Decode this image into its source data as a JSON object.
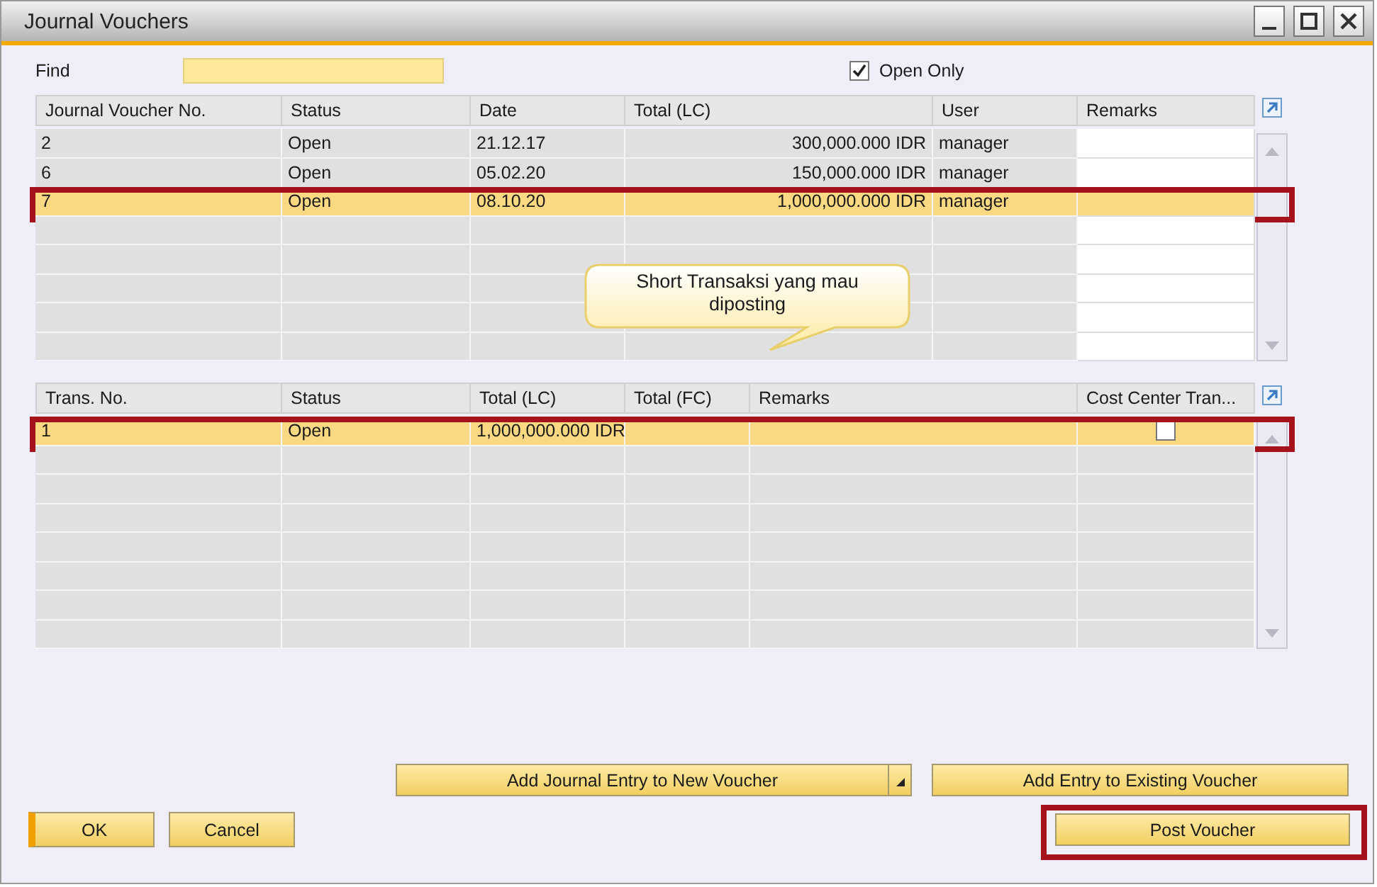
{
  "window": {
    "title": "Journal Vouchers"
  },
  "find": {
    "label": "Find"
  },
  "open_only": {
    "label": "Open Only",
    "checked": true
  },
  "vouchers": {
    "columns": [
      {
        "label": "Journal Voucher No.",
        "kind": "text"
      },
      {
        "label": "Status",
        "kind": "text"
      },
      {
        "label": "Date",
        "kind": "text"
      },
      {
        "label": "Total (LC)",
        "kind": "amount"
      },
      {
        "label": "User",
        "kind": "text"
      },
      {
        "label": "Remarks",
        "kind": "editable"
      }
    ],
    "rows": [
      {
        "cells": [
          "2",
          "Open",
          "21.12.17",
          "300,000.000 IDR",
          "manager"
        ],
        "selected": false,
        "highlighted": false
      },
      {
        "cells": [
          "6",
          "Open",
          "05.02.20",
          "150,000.000 IDR",
          "manager"
        ],
        "selected": false,
        "highlighted": false
      },
      {
        "cells": [
          "7",
          "Open",
          "08.10.20",
          "1,000,000.000 IDR",
          "manager"
        ],
        "selected": true,
        "highlighted": true
      }
    ]
  },
  "callout": {
    "text": "Short Transaksi yang mau diposting"
  },
  "lines": {
    "columns": [
      {
        "label": "Trans. No.",
        "kind": "text"
      },
      {
        "label": "Status",
        "kind": "text"
      },
      {
        "label": "Total (LC)",
        "kind": "text"
      },
      {
        "label": "Total (FC)",
        "kind": "text"
      },
      {
        "label": "Remarks",
        "kind": "text"
      },
      {
        "label": "Cost Center Tran...",
        "kind": "checkbox"
      }
    ],
    "rows": [
      {
        "cells": [
          "1",
          "Open",
          "1,000,000.000 IDR"
        ],
        "checked": false,
        "selected": true,
        "highlighted": true
      }
    ]
  },
  "actions": [
    {
      "label": "Add Journal Entry to New Voucher",
      "kind": "split"
    },
    {
      "label": "Add Entry to Existing Voucher",
      "kind": "plain"
    }
  ],
  "buttons": [
    {
      "label": "OK",
      "kind": "dialog",
      "default": true,
      "highlighted": false
    },
    {
      "label": "Cancel",
      "kind": "dialog",
      "default": false,
      "highlighted": false
    },
    {
      "label": "Post Voucher",
      "kind": "action",
      "default": false,
      "highlighted": true
    }
  ]
}
